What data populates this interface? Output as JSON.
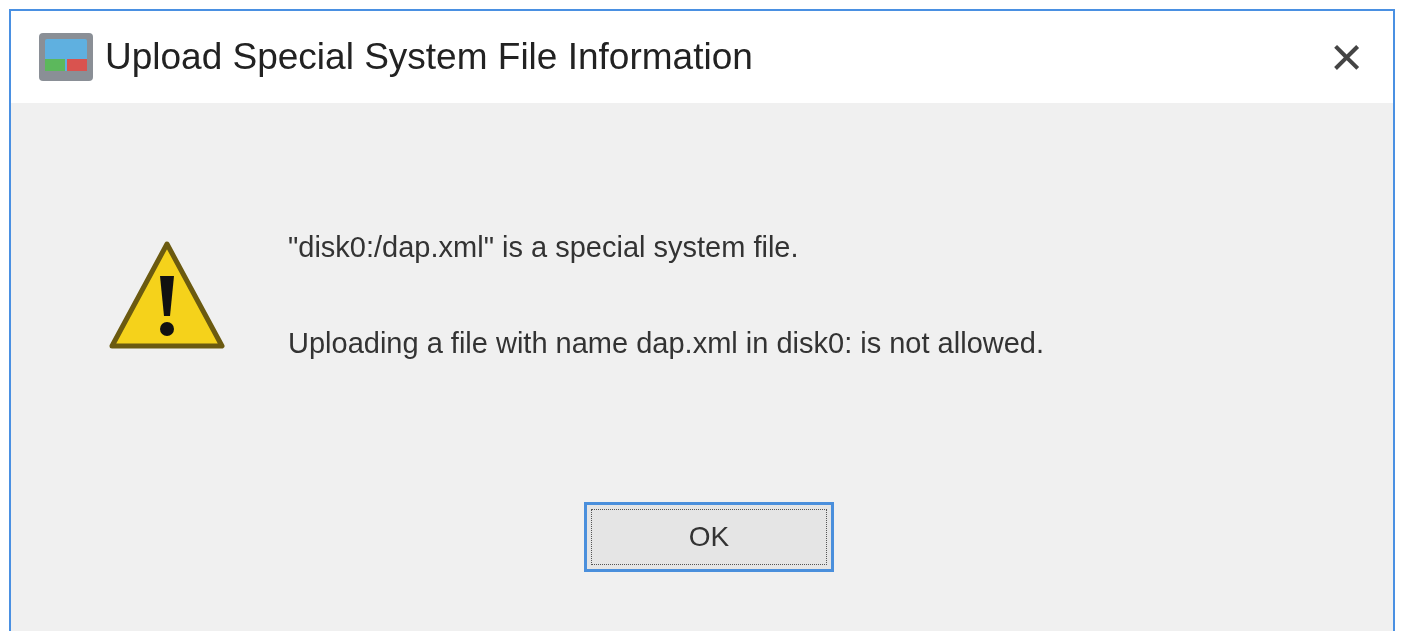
{
  "window": {
    "title": "Upload Special System File Information",
    "close": "×"
  },
  "message": [
    "\"disk0:/dap.xml\" is a special system file.",
    "Uploading a file with name dap.xml in disk0: is not allowed."
  ],
  "buttons": [
    "OK"
  ]
}
